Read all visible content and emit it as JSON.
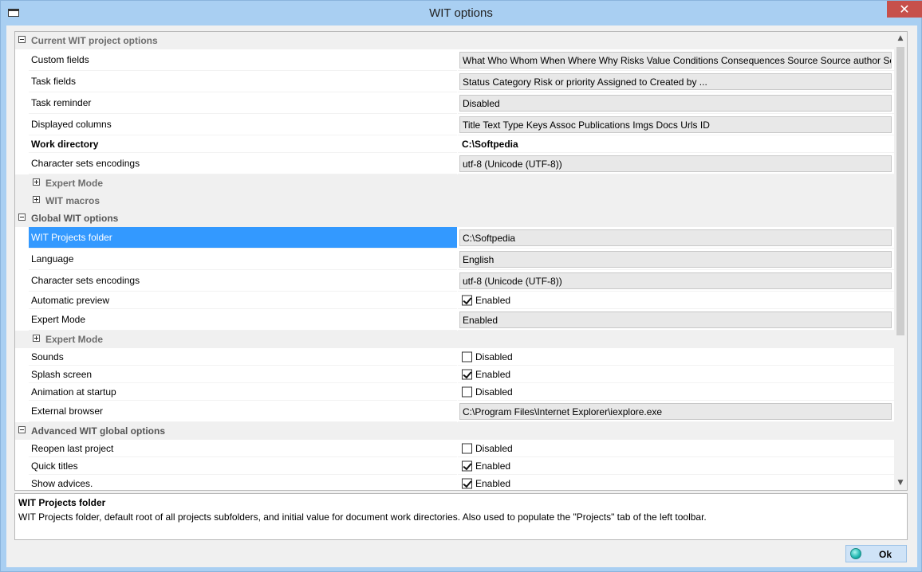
{
  "window": {
    "title": "WIT options",
    "close_glyph": "✕"
  },
  "sections": [
    {
      "label": "Current WIT project options",
      "rows": [
        {
          "label": "Custom fields",
          "value": "What Who Whom When Where Why Risks Value Conditions Consequences Source Source author Sour",
          "kind": "box"
        },
        {
          "label": "Task fields",
          "value": "Status Category Risk or priority Assigned to Created by ...",
          "kind": "box"
        },
        {
          "label": "Task reminder",
          "value": "Disabled",
          "kind": "box"
        },
        {
          "label": "Displayed columns",
          "value": "Title Text Type Keys Assoc Publications Imgs Docs Urls ID",
          "kind": "box"
        },
        {
          "label": "Work directory",
          "value": "C:\\Softpedia",
          "kind": "bold"
        },
        {
          "label": "Character sets encodings",
          "value": "utf-8 (Unicode (UTF-8))",
          "kind": "box"
        }
      ],
      "subsections": [
        "Expert Mode",
        "WIT macros"
      ]
    },
    {
      "label": "Global WIT options",
      "rows": [
        {
          "label": "WIT Projects folder",
          "value": "C:\\Softpedia",
          "kind": "box",
          "selected": true
        },
        {
          "label": "Language",
          "value": "English",
          "kind": "box"
        },
        {
          "label": "Character sets encodings",
          "value": "utf-8 (Unicode (UTF-8))",
          "kind": "box"
        },
        {
          "label": "Automatic preview",
          "value": "Enabled",
          "kind": "check",
          "checked": true
        },
        {
          "label": "Expert Mode",
          "value": "Enabled",
          "kind": "box"
        }
      ],
      "subsection": "Expert Mode",
      "rows2": [
        {
          "label": "Sounds",
          "value": "Disabled",
          "kind": "check",
          "checked": false
        },
        {
          "label": "Splash screen",
          "value": "Enabled",
          "kind": "check",
          "checked": true
        },
        {
          "label": "Animation at startup",
          "value": "Disabled",
          "kind": "check",
          "checked": false
        },
        {
          "label": "External browser",
          "value": "C:\\Program Files\\Internet Explorer\\iexplore.exe",
          "kind": "box"
        }
      ]
    },
    {
      "label": "Advanced WIT global options",
      "rows": [
        {
          "label": "Reopen last project",
          "value": "Disabled",
          "kind": "check",
          "checked": false
        },
        {
          "label": "Quick titles",
          "value": "Enabled",
          "kind": "check",
          "checked": true
        },
        {
          "label": "Show advices.",
          "value": "Enabled",
          "kind": "check",
          "checked": true
        }
      ]
    }
  ],
  "scrollbar": {
    "up": "▲",
    "down": "▼"
  },
  "description": {
    "title": "WIT Projects folder",
    "text": "WIT Projects folder, default root of all projects subfolders, and initial value for document work directories. Also used to populate the \"Projects\" tab of the left toolbar."
  },
  "ok_button": {
    "label": "Ok"
  },
  "colors": {
    "selection": "#3399ff",
    "titlebar": "#a9cff2",
    "close": "#c7504b"
  }
}
